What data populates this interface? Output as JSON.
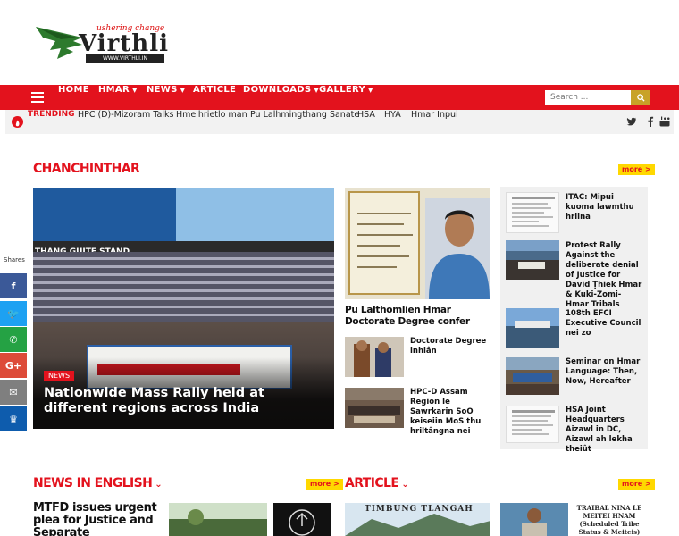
{
  "site": {
    "logo_tagline": "ushering change",
    "logo_word": "Virthli",
    "logo_url": "WWW.VIRTHLI.IN"
  },
  "nav": {
    "items": [
      {
        "label": "HOME",
        "dropdown": false
      },
      {
        "label": "HMAR",
        "dropdown": true
      },
      {
        "label": "NEWS",
        "dropdown": true
      },
      {
        "label": "ARTICLE",
        "dropdown": false
      },
      {
        "label": "DOWNLOADS",
        "dropdown": true
      },
      {
        "label": "GALLERY",
        "dropdown": true
      }
    ],
    "search_placeholder": "Search ...",
    "bg_color": "#e3121d"
  },
  "trending": {
    "label": "TRENDING",
    "items": [
      "HPC (D)-Mizoram Talks",
      "Hmelhrietlo man",
      "Pu Lalhmingthang Sanate",
      "HSA",
      "HYA",
      "Hmar Inpui"
    ]
  },
  "share": {
    "label": "Shares",
    "buttons": [
      {
        "icon": "facebook-icon",
        "glyph": "f",
        "color": "#3b5998"
      },
      {
        "icon": "twitter-icon",
        "glyph": "🐦",
        "color": "#1da1f2"
      },
      {
        "icon": "whatsapp-icon",
        "glyph": "✆",
        "color": "#25a244"
      },
      {
        "icon": "google-plus-icon",
        "glyph": "G+",
        "color": "#dd4b39"
      },
      {
        "icon": "email-icon",
        "glyph": "✉",
        "color": "#7f7f7f"
      },
      {
        "icon": "sumo-icon",
        "glyph": "♛",
        "color": "#0e5cad"
      }
    ]
  },
  "chanchinthar": {
    "title": "CHANCHINTHAR",
    "more": "more >",
    "featured": {
      "badge": "NEWS",
      "title": "Nationwide Mass Rally held at different regions across India",
      "stand_text": "THANG GUITE STAND"
    },
    "middle": {
      "title": "Pu Lalthomlien Hmar Doctorate Degree confer",
      "items": [
        {
          "title": "Doctorate Degree inhlân"
        },
        {
          "title": "HPC-D Assam Region le Sawrkarin SoO keiseiin MoS thu hriltângna nei"
        }
      ]
    },
    "right": [
      {
        "title": "ITAC: Mipui kuoma lawmthu hrilna"
      },
      {
        "title": "Protest Rally Against the deliberate denial of Justice for David Ṭhiek Hmar & Kuki-Zomi-Hmar Tribals"
      },
      {
        "title": "108th EFCI Executive Council nei zo"
      },
      {
        "title": "Seminar on Hmar Language: Then, Now, Hereafter"
      },
      {
        "title": "HSA Joint Headquarters Aizawl in DC, Aizawl ah lekha theiût"
      }
    ]
  },
  "news_in_english": {
    "title": "NEWS IN ENGLISH",
    "more": "more >",
    "headline": "MTFD issues urgent plea for Justice and Separate"
  },
  "article": {
    "title": "ARTICLE",
    "more": "more >",
    "image_text": "TIMBUNG TLANGAH",
    "tribal_text": "TRAIBAL NINA LE MEITEI HNAM (Scheduled Tribe Status & Meiteis)"
  }
}
